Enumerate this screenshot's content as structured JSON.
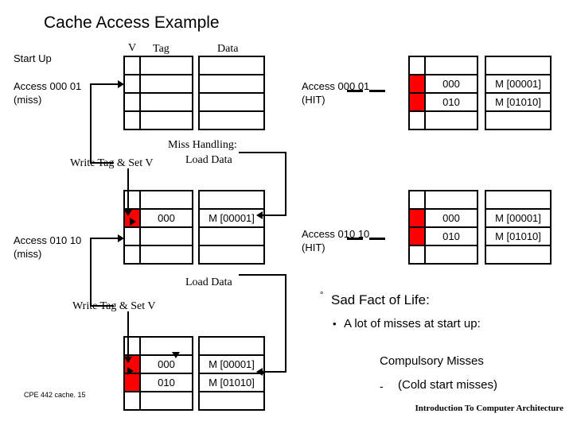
{
  "title": "Cache Access Example",
  "headers": {
    "v": "V",
    "tag": "Tag",
    "data": "Data"
  },
  "labels": {
    "start_up": "Start Up",
    "access1": "Access 000 01",
    "access1_state": "(miss)",
    "access2": "Access 010 10",
    "access2_state": "(miss)",
    "hit1": "Access 000 01",
    "hit1_state": "(HIT)",
    "hit2": "Access 010 10",
    "hit2_state": "(HIT)",
    "miss_handling": "Miss Handling:",
    "write_tag1": "Write Tag & Set V",
    "load_data1": "Load Data",
    "load_data2": "Load Data",
    "write_tag2": "Write Tag & Set V"
  },
  "cells": {
    "tag_000": "000",
    "tag_010": "010",
    "data_00001": "M [00001]",
    "data_01010": "M [01010]"
  },
  "notes": {
    "heading": "Sad Fact of Life:",
    "bullet1": "A lot of misses at start up:",
    "line2": "Compulsory Misses",
    "line3": "(Cold start misses)",
    "bullet_marker": "°",
    "bullet_dot": "•",
    "dash_marker": "-"
  },
  "footer": {
    "left": "CPE 442  cache. 15",
    "right": "Introduction To Computer Architecture"
  },
  "colors": {
    "highlight": "#ff0000",
    "ink": "#000000",
    "bg": "#ffffff"
  }
}
